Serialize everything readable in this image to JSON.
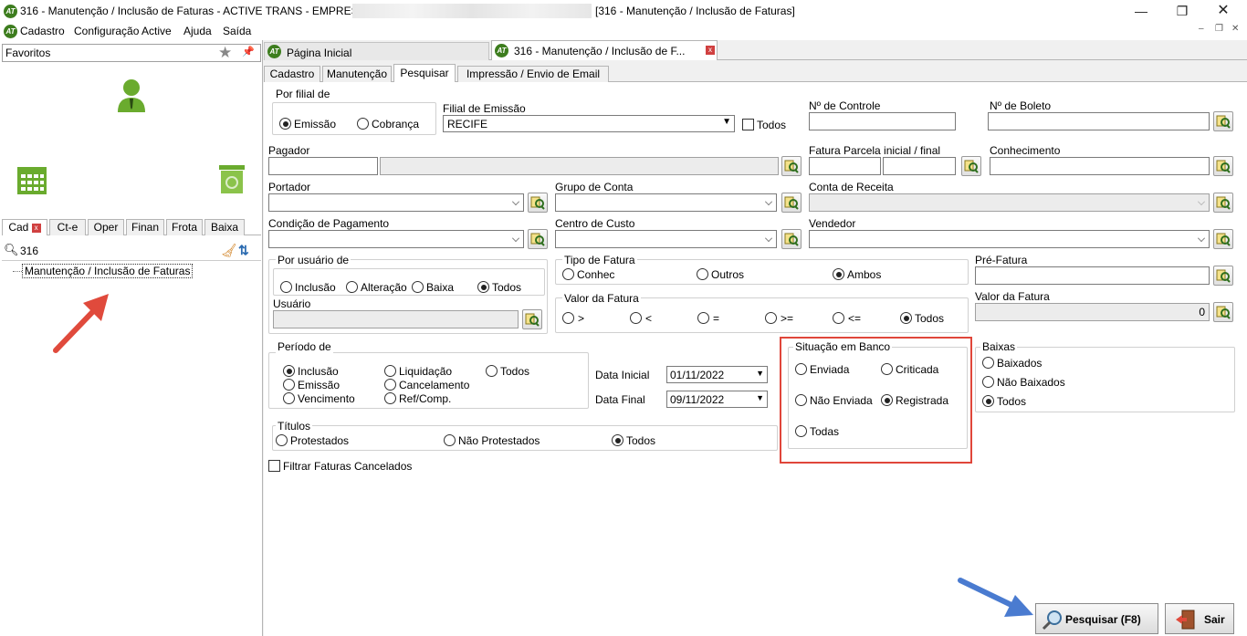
{
  "window": {
    "title": "316 - Manutenção / Inclusão de Faturas - ACTIVE TRANS - EMPRESA:",
    "title_suffix": "[316 - Manutenção / Inclusão de Faturas]",
    "logo": "AT"
  },
  "menu": [
    "Cadastro",
    "Configuração Active",
    "Ajuda",
    "Saída"
  ],
  "left": {
    "favorites_label": "Favoritos",
    "tabs": [
      "Cad",
      "Ct-e",
      "Oper",
      "Finan",
      "Frota",
      "Baixa"
    ],
    "search_value": "316",
    "tree_item": "Manutenção / Inclusão de Faturas"
  },
  "doc_tabs": [
    {
      "label": "Página Inicial"
    },
    {
      "label": "316 - Manutenção / Inclusão de F..."
    }
  ],
  "sub_tabs": [
    "Cadastro",
    "Manutenção",
    "Pesquisar",
    "Impressão / Envio de Email"
  ],
  "form": {
    "por_filial": {
      "title": "Por filial de",
      "options": [
        "Emissão",
        "Cobrança"
      ],
      "selected": "Emissão"
    },
    "filial_emissao": {
      "label": "Filial de Emissão",
      "value": "RECIFE",
      "todos": "Todos"
    },
    "nro_controle": "Nº de Controle",
    "nro_boleto": "Nº de Boleto",
    "pagador": "Pagador",
    "fatura_parcela": "Fatura Parcela inicial / final",
    "conhecimento": "Conhecimento",
    "portador": "Portador",
    "grupo_conta": "Grupo de Conta",
    "conta_receita": "Conta de Receita",
    "condicao_pagamento": "Condição de Pagamento",
    "centro_custo": "Centro de Custo",
    "vendedor": "Vendedor",
    "por_usuario": {
      "title": "Por usuário de",
      "options": [
        "Inclusão",
        "Alteração",
        "Baixa",
        "Todos"
      ],
      "selected": "Todos",
      "usuario": "Usuário"
    },
    "tipo_fatura": {
      "title": "Tipo de Fatura",
      "options": [
        "Conhec",
        "Outros",
        "Ambos"
      ],
      "selected": "Ambos"
    },
    "pre_fatura": "Pré-Fatura",
    "valor_fatura": {
      "title": "Valor da Fatura",
      "options": [
        ">",
        "<",
        "=",
        ">=",
        "<=",
        "Todos"
      ],
      "selected": "Todos"
    },
    "valor_fatura_field": {
      "label": "Valor da Fatura",
      "value": "0"
    },
    "periodo": {
      "title": "Período de",
      "options": [
        "Inclusão",
        "Liquidação",
        "Todos",
        "Emissão",
        "Cancelamento",
        "Vencimento",
        "Ref/Comp."
      ],
      "selected": "Inclusão"
    },
    "data_inicial": {
      "label": "Data Inicial",
      "value": "01/11/2022"
    },
    "data_final": {
      "label": "Data Final",
      "value": "09/11/2022"
    },
    "situacao_banco": {
      "title": "Situação em Banco",
      "options": [
        "Enviada",
        "Criticada",
        "Não Enviada",
        "Registrada",
        "Todas"
      ],
      "selected": "Registrada"
    },
    "baixas": {
      "title": "Baixas",
      "options": [
        "Baixados",
        "Não Baixados",
        "Todos"
      ],
      "selected": "Todos"
    },
    "titulos": {
      "title": "Títulos",
      "options": [
        "Protestados",
        "Não Protestados",
        "Todos"
      ],
      "selected": "Todos"
    },
    "filtrar_cancelados": "Filtrar Faturas Cancelados"
  },
  "buttons": {
    "pesquisar": "Pesquisar (F8)",
    "sair": "Sair"
  },
  "colors": {
    "highlight": "#e0463a",
    "arrow_red": "#e04a3c",
    "arrow_blue": "#4a7bd0",
    "icon_green": "#6aab2e"
  }
}
